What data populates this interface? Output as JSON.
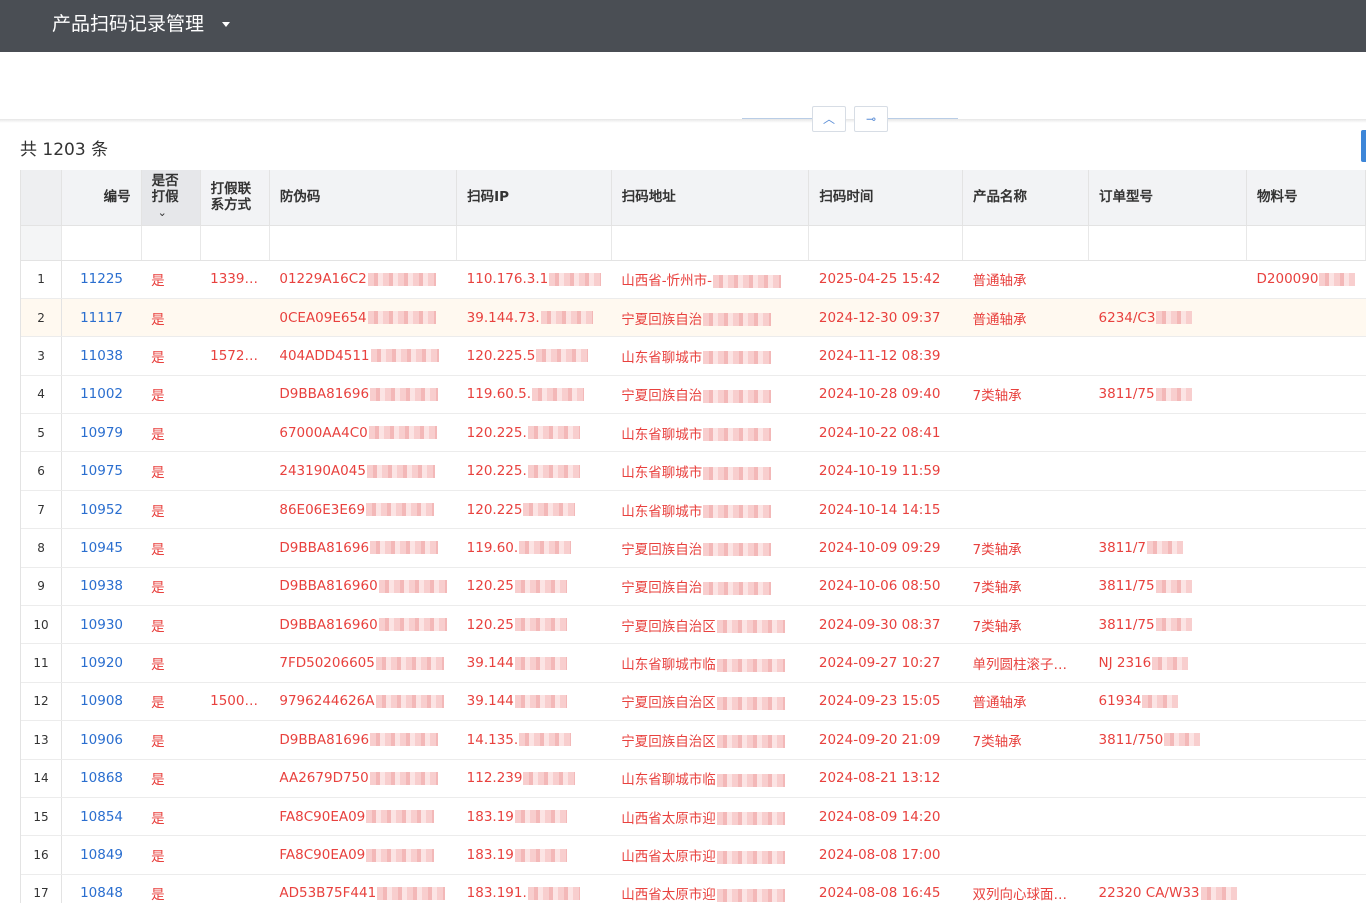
{
  "app": {
    "title": "产品扫码记录管理"
  },
  "summary": {
    "total_text": "共 1203 条"
  },
  "controls": {
    "collapse_icon": "chevron-up-icon",
    "pin_icon": "pin-icon"
  },
  "colors": {
    "header_bar": "#4a4e54",
    "value_red": "#e8413e",
    "id_blue": "#2a6ecf",
    "accent_blue": "#3d86d8"
  },
  "columns": {
    "id": "编号",
    "fake_line1": "是否",
    "fake_line2": "打假",
    "contact_line1": "打假联",
    "contact_line2": "系方式",
    "code": "防伪码",
    "ip": "扫码IP",
    "addr": "扫码地址",
    "time": "扫码时间",
    "product": "产品名称",
    "order": "订单型号",
    "material": "物料号"
  },
  "rows": [
    {
      "n": "1",
      "id": "11225",
      "fake": "是",
      "contact": "1339…",
      "code": "01229A16C2",
      "ip": "110.176.3.1",
      "addr": "山西省-忻州市-",
      "time": "2025-04-25 15:42",
      "product": "普通轴承",
      "order": "",
      "material": "D200090"
    },
    {
      "n": "2",
      "id": "11117",
      "fake": "是",
      "contact": "",
      "code": "0CEA09E654",
      "ip": "39.144.73.",
      "addr": "宁夏回族自治",
      "time": "2024-12-30 09:37",
      "product": "普通轴承",
      "order": "6234/C3",
      "material": ""
    },
    {
      "n": "3",
      "id": "11038",
      "fake": "是",
      "contact": "1572…",
      "code": "404ADD4511",
      "ip": "120.225.5",
      "addr": "山东省聊城市",
      "time": "2024-11-12 08:39",
      "product": "",
      "order": "",
      "material": ""
    },
    {
      "n": "4",
      "id": "11002",
      "fake": "是",
      "contact": "",
      "code": "D9BBA81696",
      "ip": "119.60.5.",
      "addr": "宁夏回族自治",
      "time": "2024-10-28 09:40",
      "product": "7类轴承",
      "order": "3811/75",
      "material": ""
    },
    {
      "n": "5",
      "id": "10979",
      "fake": "是",
      "contact": "",
      "code": "67000AA4C0",
      "ip": "120.225.",
      "addr": "山东省聊城市",
      "time": "2024-10-22 08:41",
      "product": "",
      "order": "",
      "material": ""
    },
    {
      "n": "6",
      "id": "10975",
      "fake": "是",
      "contact": "",
      "code": "243190A045",
      "ip": "120.225.",
      "addr": "山东省聊城市",
      "time": "2024-10-19 11:59",
      "product": "",
      "order": "",
      "material": ""
    },
    {
      "n": "7",
      "id": "10952",
      "fake": "是",
      "contact": "",
      "code": "86E06E3E69",
      "ip": "120.225",
      "addr": "山东省聊城市",
      "time": "2024-10-14 14:15",
      "product": "",
      "order": "",
      "material": ""
    },
    {
      "n": "8",
      "id": "10945",
      "fake": "是",
      "contact": "",
      "code": "D9BBA81696",
      "ip": "119.60.",
      "addr": "宁夏回族自治",
      "time": "2024-10-09 09:29",
      "product": "7类轴承",
      "order": "3811/7",
      "material": ""
    },
    {
      "n": "9",
      "id": "10938",
      "fake": "是",
      "contact": "",
      "code": "D9BBA816960",
      "ip": "120.25",
      "addr": "宁夏回族自治",
      "time": "2024-10-06 08:50",
      "product": "7类轴承",
      "order": "3811/75",
      "material": ""
    },
    {
      "n": "10",
      "id": "10930",
      "fake": "是",
      "contact": "",
      "code": "D9BBA816960",
      "ip": "120.25",
      "addr": "宁夏回族自治区",
      "time": "2024-09-30 08:37",
      "product": "7类轴承",
      "order": "3811/75",
      "material": ""
    },
    {
      "n": "11",
      "id": "10920",
      "fake": "是",
      "contact": "",
      "code": "7FD50206605",
      "ip": "39.144",
      "addr": "山东省聊城市临",
      "time": "2024-09-27 10:27",
      "product": "单列圆柱滚子…",
      "order": "NJ 2316",
      "material": ""
    },
    {
      "n": "12",
      "id": "10908",
      "fake": "是",
      "contact": "1500…",
      "code": "9796244626A",
      "ip": "39.144",
      "addr": "宁夏回族自治区",
      "time": "2024-09-23 15:05",
      "product": "普通轴承",
      "order": "61934",
      "material": ""
    },
    {
      "n": "13",
      "id": "10906",
      "fake": "是",
      "contact": "",
      "code": "D9BBA81696",
      "ip": "14.135.",
      "addr": "宁夏回族自治区",
      "time": "2024-09-20 21:09",
      "product": "7类轴承",
      "order": "3811/750",
      "material": ""
    },
    {
      "n": "14",
      "id": "10868",
      "fake": "是",
      "contact": "",
      "code": "AA2679D750",
      "ip": "112.239",
      "addr": "山东省聊城市临",
      "time": "2024-08-21 13:12",
      "product": "",
      "order": "",
      "material": ""
    },
    {
      "n": "15",
      "id": "10854",
      "fake": "是",
      "contact": "",
      "code": "FA8C90EA09",
      "ip": "183.19",
      "addr": "山西省太原市迎",
      "time": "2024-08-09 14:20",
      "product": "",
      "order": "",
      "material": ""
    },
    {
      "n": "16",
      "id": "10849",
      "fake": "是",
      "contact": "",
      "code": "FA8C90EA09",
      "ip": "183.19",
      "addr": "山西省太原市迎",
      "time": "2024-08-08 17:00",
      "product": "",
      "order": "",
      "material": ""
    },
    {
      "n": "17",
      "id": "10848",
      "fake": "是",
      "contact": "",
      "code": "AD53B75F441",
      "ip": "183.191.",
      "addr": "山西省太原市迎",
      "time": "2024-08-08 16:45",
      "product": "双列向心球面…",
      "order": "22320 CA/W33",
      "material": ""
    }
  ]
}
